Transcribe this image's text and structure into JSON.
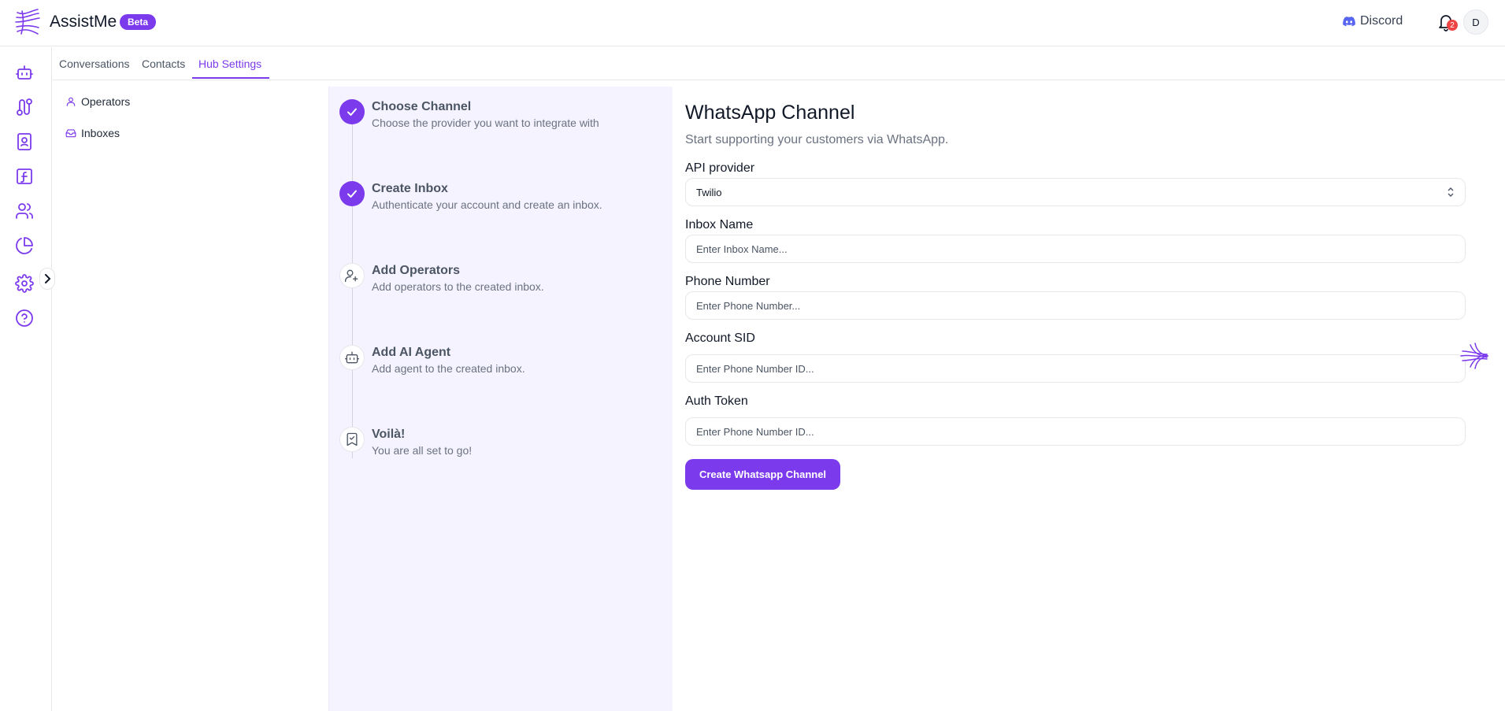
{
  "header": {
    "app_name": "AssistMe",
    "badge": "Beta",
    "discord_label": "Discord",
    "notification_count": "2",
    "avatar_initial": "D"
  },
  "rail": {
    "icons": [
      "bot-icon",
      "workflow-icon",
      "contacts-book-icon",
      "function-icon",
      "users-icon",
      "pie-chart-icon",
      "gear-icon",
      "help-icon"
    ]
  },
  "tabs": [
    {
      "label": "Conversations"
    },
    {
      "label": "Contacts"
    },
    {
      "label": "Hub Settings",
      "active": true
    }
  ],
  "subnav": [
    {
      "label": "Operators"
    },
    {
      "label": "Inboxes"
    }
  ],
  "steps": [
    {
      "title": "Choose Channel",
      "desc": "Choose the provider you want to integrate with",
      "status": "done"
    },
    {
      "title": "Create Inbox",
      "desc": "Authenticate your account and create an inbox.",
      "status": "done"
    },
    {
      "title": "Add Operators",
      "desc": "Add operators to the created inbox.",
      "status": "todo"
    },
    {
      "title": "Add AI Agent",
      "desc": "Add agent to the created inbox.",
      "status": "todo"
    },
    {
      "title": "Voilà!",
      "desc": "You are all set to go!",
      "status": "todo"
    }
  ],
  "form": {
    "title": "WhatsApp Channel",
    "subtitle": "Start supporting your customers via WhatsApp.",
    "api_provider_label": "API provider",
    "api_provider_value": "Twilio",
    "inbox_name_label": "Inbox Name",
    "inbox_name_placeholder": "Enter Inbox Name...",
    "phone_label": "Phone Number",
    "phone_placeholder": "Enter Phone Number...",
    "sid_label": "Account SID",
    "sid_placeholder": "Enter Phone Number ID...",
    "token_label": "Auth Token",
    "token_placeholder": "Enter Phone Number ID...",
    "submit_label": "Create Whatsapp Channel"
  },
  "colors": {
    "accent": "#7c3aed",
    "panel_bg": "#f5f3ff",
    "badge_red": "#ef4444"
  }
}
